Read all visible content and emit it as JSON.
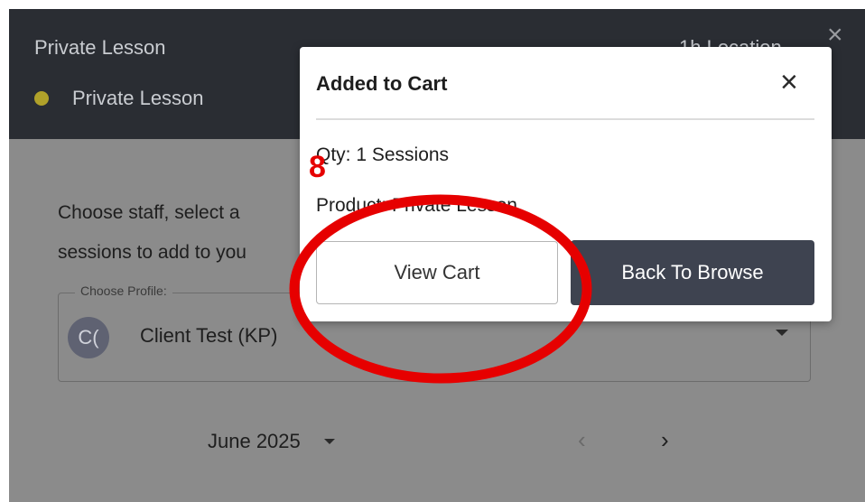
{
  "app": {
    "header": {
      "title": "Private Lesson",
      "subtitle": "Private Lesson",
      "right_text": "1h Location",
      "close_glyph": "×",
      "dot_color": "#b0a12a"
    },
    "intro": {
      "line1": "Choose staff, select a",
      "line2": "sessions to add to you"
    },
    "profile": {
      "label": "Choose Profile:",
      "avatar_initials": "C(",
      "name": "Client Test (KP)"
    },
    "calendar": {
      "month": "June 2025",
      "prev_glyph": "‹",
      "next_glyph": "›"
    }
  },
  "modal": {
    "title": "Added to Cart",
    "close_glyph": "×",
    "qty_text": "Qty: 1 Sessions",
    "product_text": "Product: Private Lesson",
    "view_cart_label": "View Cart",
    "back_to_browse_label": "Back To Browse",
    "primary_color": "#3e4350"
  },
  "annotation": {
    "step_number": "8",
    "color": "#e60000"
  }
}
